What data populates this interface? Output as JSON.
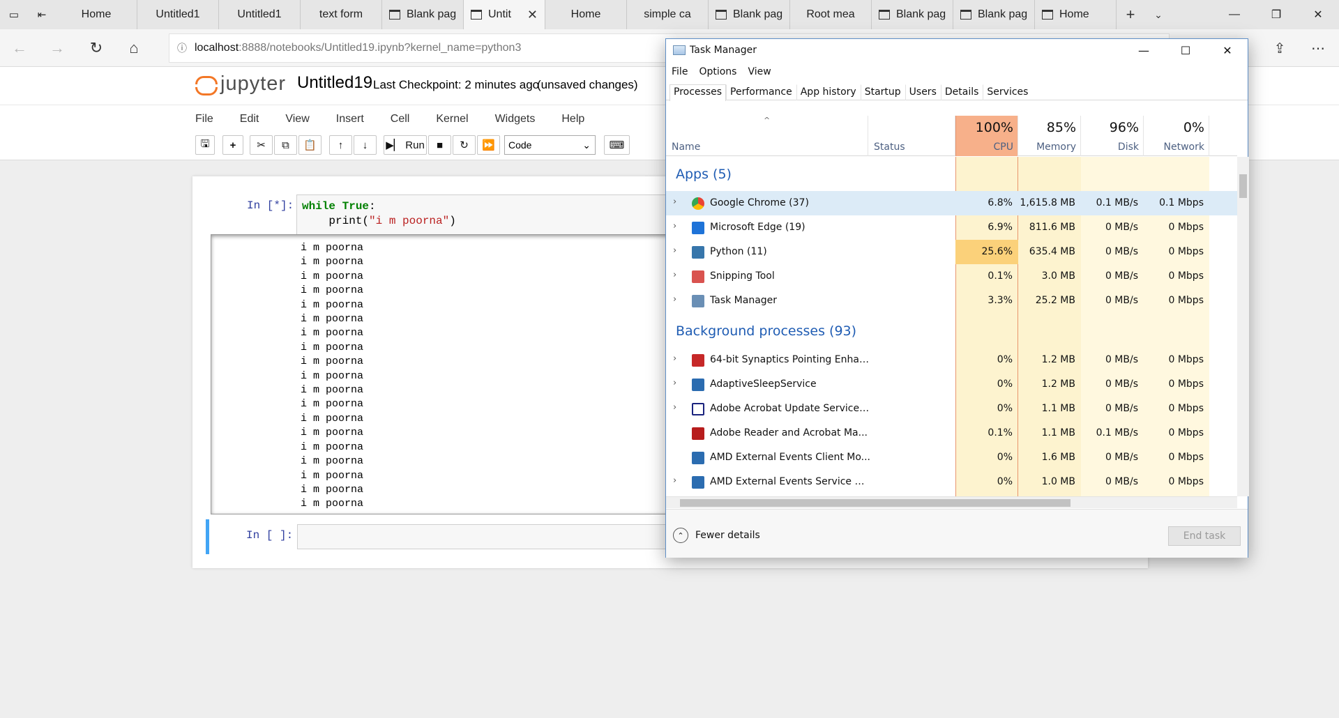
{
  "browser": {
    "tabs": [
      {
        "label": "Home",
        "icon": false,
        "active": false
      },
      {
        "label": "Untitled1",
        "icon": false,
        "active": false
      },
      {
        "label": "Untitled1",
        "icon": false,
        "active": false
      },
      {
        "label": "text form",
        "icon": false,
        "active": false
      },
      {
        "label": "Blank pag",
        "icon": true,
        "active": false
      },
      {
        "label": "Untit",
        "icon": true,
        "active": true
      },
      {
        "label": "Home",
        "icon": false,
        "active": false
      },
      {
        "label": "simple ca",
        "icon": false,
        "active": false
      },
      {
        "label": "Blank pag",
        "icon": true,
        "active": false
      },
      {
        "label": "Root mea",
        "icon": false,
        "active": false
      },
      {
        "label": "Blank pag",
        "icon": true,
        "active": false
      },
      {
        "label": "Blank pag",
        "icon": true,
        "active": false
      },
      {
        "label": "Home",
        "icon": true,
        "active": false
      }
    ],
    "url_host": "localhost",
    "url_path": ":8888/notebooks/Untitled19.ipynb?kernel_name=python3"
  },
  "jupyter": {
    "logo_text": "jupyter",
    "notebook_name": "Untitled19",
    "checkpoint": "Last Checkpoint: 2 minutes ago",
    "unsaved": "(unsaved changes)",
    "menu": [
      "File",
      "Edit",
      "View",
      "Insert",
      "Cell",
      "Kernel",
      "Widgets",
      "Help"
    ],
    "run_label": "Run",
    "cell_type": "Code",
    "cell1": {
      "prompt": "In [*]:",
      "kw_while": "while",
      "kw_true": "True",
      "colon": ":",
      "print_start": "    print(",
      "string": "\"i m poorna\"",
      "print_end": ")"
    },
    "output_line": "i m poorna",
    "output_count": 19,
    "cell2_prompt": "In [ ]:"
  },
  "task_manager": {
    "title": "Task Manager",
    "menu": [
      "File",
      "Options",
      "View"
    ],
    "tabs": [
      "Processes",
      "Performance",
      "App history",
      "Startup",
      "Users",
      "Details",
      "Services"
    ],
    "columns": {
      "name": "Name",
      "status": "Status",
      "cpu_pct": "100%",
      "cpu": "CPU",
      "mem_pct": "85%",
      "mem": "Memory",
      "disk_pct": "96%",
      "disk": "Disk",
      "net_pct": "0%",
      "net": "Network"
    },
    "apps_header": "Apps (5)",
    "apps": [
      {
        "name": "Google Chrome (37)",
        "cpu": "6.8%",
        "mem": "1,615.8 MB",
        "disk": "0.1 MB/s",
        "net": "0.1 Mbps",
        "icon": "chrome-icon",
        "color": "#4285f4",
        "expand": true
      },
      {
        "name": "Microsoft Edge (19)",
        "cpu": "6.9%",
        "mem": "811.6 MB",
        "disk": "0 MB/s",
        "net": "0 Mbps",
        "icon": "edge-icon",
        "color": "#1e73d8",
        "expand": true
      },
      {
        "name": "Python (11)",
        "cpu": "25.6%",
        "mem": "635.4 MB",
        "disk": "0 MB/s",
        "net": "0 Mbps",
        "icon": "python-icon",
        "color": "#3776ab",
        "expand": true
      },
      {
        "name": "Snipping Tool",
        "cpu": "0.1%",
        "mem": "3.0 MB",
        "disk": "0 MB/s",
        "net": "0 Mbps",
        "icon": "scissors-icon",
        "color": "#d9534f",
        "expand": true
      },
      {
        "name": "Task Manager",
        "cpu": "3.3%",
        "mem": "25.2 MB",
        "disk": "0 MB/s",
        "net": "0 Mbps",
        "icon": "task-manager-icon",
        "color": "#6a8fb5",
        "expand": true
      }
    ],
    "bg_header": "Background processes (93)",
    "background": [
      {
        "name": "64-bit Synaptics Pointing Enhan...",
        "cpu": "0%",
        "mem": "1.2 MB",
        "disk": "0 MB/s",
        "net": "0 Mbps",
        "icon": "synaptics-icon",
        "color": "#c62828",
        "expand": true
      },
      {
        "name": "AdaptiveSleepService",
        "cpu": "0%",
        "mem": "1.2 MB",
        "disk": "0 MB/s",
        "net": "0 Mbps",
        "icon": "service-icon",
        "color": "#2b6cb0",
        "expand": true
      },
      {
        "name": "Adobe Acrobat Update Service ...",
        "cpu": "0%",
        "mem": "1.1 MB",
        "disk": "0 MB/s",
        "net": "0 Mbps",
        "icon": "window-icon",
        "color": "#1a237e",
        "expand": true
      },
      {
        "name": "Adobe Reader and Acrobat Ma...",
        "cpu": "0.1%",
        "mem": "1.1 MB",
        "disk": "0.1 MB/s",
        "net": "0 Mbps",
        "icon": "acrobat-icon",
        "color": "#b71c1c",
        "expand": false
      },
      {
        "name": "AMD External Events Client Mo...",
        "cpu": "0%",
        "mem": "1.6 MB",
        "disk": "0 MB/s",
        "net": "0 Mbps",
        "icon": "service-icon",
        "color": "#2b6cb0",
        "expand": false
      },
      {
        "name": "AMD External Events Service M...",
        "cpu": "0%",
        "mem": "1.0 MB",
        "disk": "0 MB/s",
        "net": "0 Mbps",
        "icon": "service-icon",
        "color": "#2b6cb0",
        "expand": true
      }
    ],
    "fewer_details": "Fewer details",
    "end_task": "End task"
  }
}
